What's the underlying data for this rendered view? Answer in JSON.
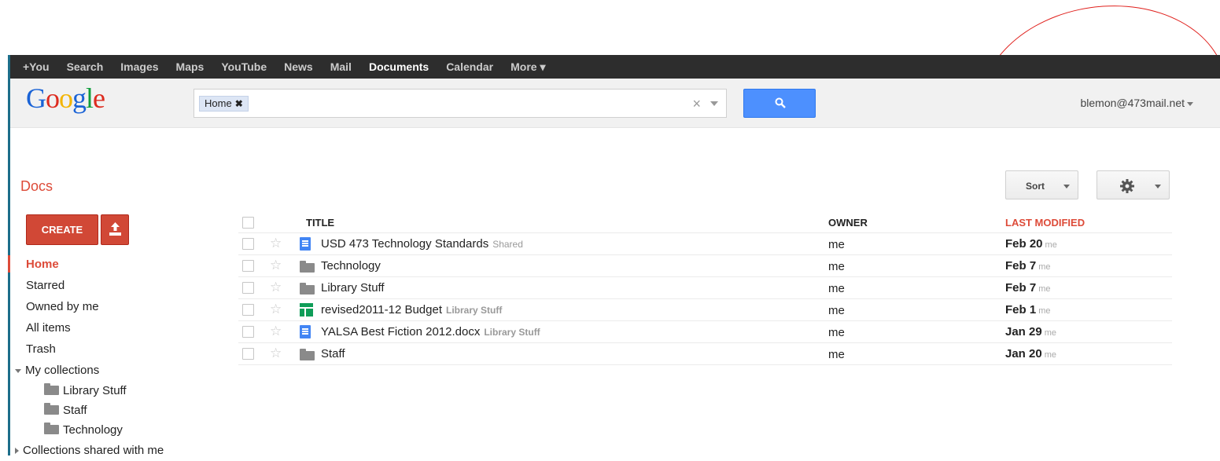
{
  "topbar": {
    "links": [
      "+You",
      "Search",
      "Images",
      "Maps",
      "YouTube",
      "News",
      "Mail",
      "Documents",
      "Calendar",
      "More ▾"
    ]
  },
  "header": {
    "logo": "Google",
    "search_chip": "Home",
    "search_value": "",
    "account": "blemon@473mail.net"
  },
  "page_title": "Docs",
  "toolbar": {
    "sort_label": "Sort"
  },
  "sidebar": {
    "create_label": "CREATE",
    "items": [
      "Home",
      "Starred",
      "Owned by me",
      "All items",
      "Trash"
    ],
    "my_collections_label": "My collections",
    "collections": [
      "Library Stuff",
      "Staff",
      "Technology"
    ],
    "shared_label": "Collections shared with me"
  },
  "table": {
    "headers": {
      "title": "TITLE",
      "owner": "OWNER",
      "modified": "LAST MODIFIED"
    },
    "rows": [
      {
        "title": "USD 473 Technology Standards",
        "tag": "Shared",
        "type": "doc",
        "owner": "me",
        "modified": "Feb 20",
        "by": "me"
      },
      {
        "title": "Technology",
        "tag": "",
        "type": "folder",
        "owner": "me",
        "modified": "Feb 7",
        "by": "me"
      },
      {
        "title": "Library Stuff",
        "tag": "",
        "type": "folder",
        "owner": "me",
        "modified": "Feb 7",
        "by": "me"
      },
      {
        "title": "revised2011-12 Budget",
        "tag": "Library Stuff",
        "type": "sheet",
        "owner": "me",
        "modified": "Feb 1",
        "by": "me"
      },
      {
        "title": "YALSA Best Fiction 2012.docx",
        "tag": "Library Stuff",
        "type": "doc",
        "owner": "me",
        "modified": "Jan 29",
        "by": "me"
      },
      {
        "title": "Staff",
        "tag": "",
        "type": "folder",
        "owner": "me",
        "modified": "Jan 20",
        "by": "me"
      }
    ]
  },
  "colors": {
    "accent_red": "#dd4b39",
    "search_blue": "#4d90fe",
    "annotation": "#e0211d"
  }
}
